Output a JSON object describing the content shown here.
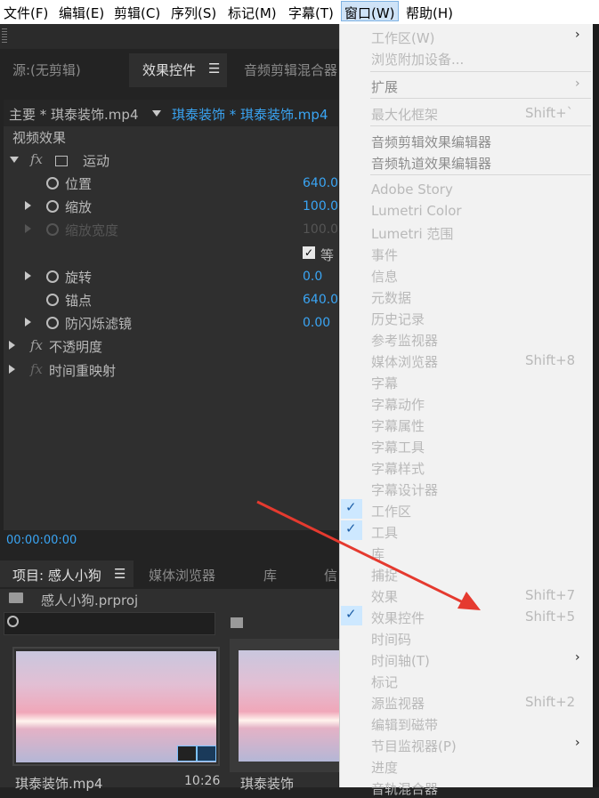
{
  "menubar": [
    "文件(F)",
    "编辑(E)",
    "剪辑(C)",
    "序列(S)",
    "标记(M)",
    "字幕(T)",
    "窗口(W)",
    "帮助(H)"
  ],
  "tabs": {
    "source": "源:(无剪辑)",
    "effect_controls": "效果控件",
    "audio_mixer": "音频剪辑混合器",
    "menu_icon": "☰"
  },
  "effect_controls": {
    "master": "主要 * 琪泰装饰.mp4",
    "sequence": "琪泰装饰 * 琪泰装饰.mp4",
    "video_effects": "视频效果",
    "motion": "运动",
    "position": "位置",
    "position_val": "640.0",
    "scale": "缩放",
    "scale_val": "100.0",
    "scale_width": "缩放宽度",
    "scale_width_val": "100.0",
    "uniform": "等",
    "rotation": "旋转",
    "rotation_val": "0.0",
    "anchor": "锚点",
    "anchor_val": "640.0",
    "flicker": "防闪烁滤镜",
    "flicker_val": "0.00",
    "opacity": "不透明度",
    "time_remap": "时间重映射",
    "fx": "fx",
    "timecode": "00:00:00:00"
  },
  "project": {
    "tab": "项目: 感人小狗",
    "menu_icon": "☰",
    "media_browser": "媒体浏览器",
    "library": "库",
    "info": "信",
    "file": "感人小狗.prproj",
    "clip1": "琪泰装饰.mp4",
    "clip1_dur": "10:26",
    "clip2": "琪泰装饰"
  },
  "window_menu": {
    "workspace": "工作区(W)",
    "browse_addons": "浏览附加设备...",
    "extensions": "扩展",
    "maximize": "最大化框架",
    "maximize_sc": "Shift+`",
    "audio_clip_effect": "音频剪辑效果编辑器",
    "audio_track_effect": "音频轨道效果编辑器",
    "items": [
      "Adobe Story",
      "Lumetri Color",
      "Lumetri 范围",
      "事件",
      "信息",
      "元数据",
      "历史记录",
      "参考监视器",
      "媒体浏览器",
      "字幕",
      "字幕动作",
      "字幕属性",
      "字幕工具",
      "字幕样式",
      "字幕设计器",
      "工作区",
      "工具",
      "库",
      "捕捉",
      "效果",
      "效果控件",
      "时间码",
      "时间轴(T)",
      "标记",
      "源监视器",
      "编辑到磁带",
      "节目监视器(P)",
      "进度",
      "音轨混合器"
    ],
    "media_browser_sc": "Shift+8",
    "effects_sc": "Shift+7",
    "effect_controls_sc": "Shift+5",
    "source_monitor_sc": "Shift+2",
    "check": "✓",
    "arrow": "›"
  }
}
